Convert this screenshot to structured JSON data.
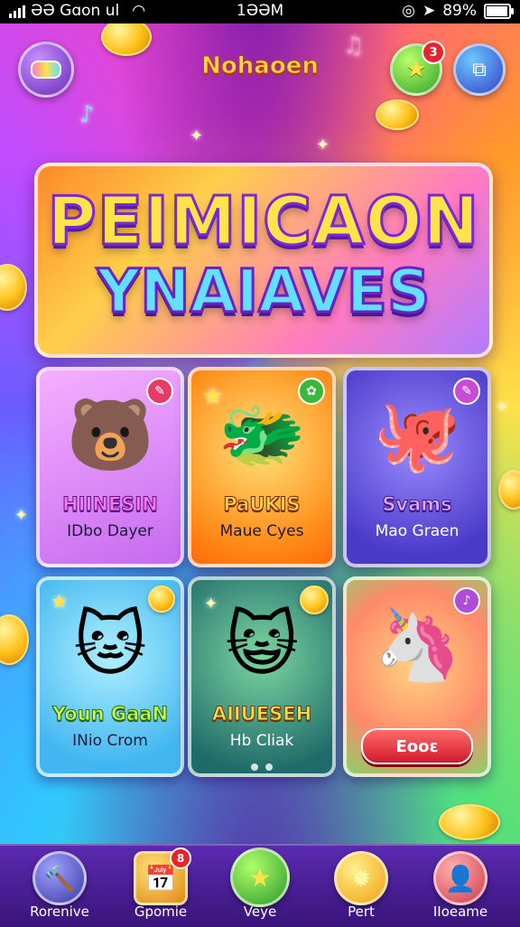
{
  "status_bar": {
    "carrier": "ƏƏ Gɑon ul",
    "time": "1ƏƏM",
    "battery": "89%",
    "battery_level": 0.89
  },
  "top_bar": {
    "title": "Nohaoen",
    "notification_count": "3",
    "menu_icon": "ring-icon",
    "star_icon": "star-icon",
    "share_icon": "share-icon"
  },
  "hero": {
    "line1": "PEIMICAON",
    "line2": "YNAIAVES"
  },
  "cards": [
    {
      "title": "HIINESIN",
      "subtitle": "IDbo Dayer",
      "icon": "bear-icon",
      "corner": "✎"
    },
    {
      "title": "PaUKIS",
      "subtitle": "Maue Cyes",
      "icon": "dragon-icon",
      "corner": "✿"
    },
    {
      "title": "Svams",
      "subtitle": "Mao Graen",
      "icon": "blob-creature-icon",
      "corner": "✎"
    },
    {
      "title": "Youn GaaN",
      "subtitle": "INio Crom",
      "icon": "girl-cat-icon",
      "corner": ""
    },
    {
      "title": "AIIUESEH",
      "subtitle": "Hb Cliak",
      "icon": "cat-cheer-icon",
      "corner": ""
    },
    {
      "title": "",
      "subtitle": "",
      "icon": "jelly-creature-icon",
      "corner": "♪",
      "button": "Eooɛ"
    }
  ],
  "bottom_nav": [
    {
      "label": "Rorenive",
      "icon": "hammer-icon"
    },
    {
      "label": "Gpomie",
      "icon": "calendar-icon",
      "badge": "8"
    },
    {
      "label": "Veye",
      "icon": "star-icon"
    },
    {
      "label": "Pert",
      "icon": "sun-gear-icon"
    },
    {
      "label": "IIoeame",
      "icon": "profile-icon"
    }
  ],
  "colors": {
    "accent_purple": "#6a2ab8",
    "accent_gold": "#ffd84a",
    "badge_red": "#e8232e"
  }
}
